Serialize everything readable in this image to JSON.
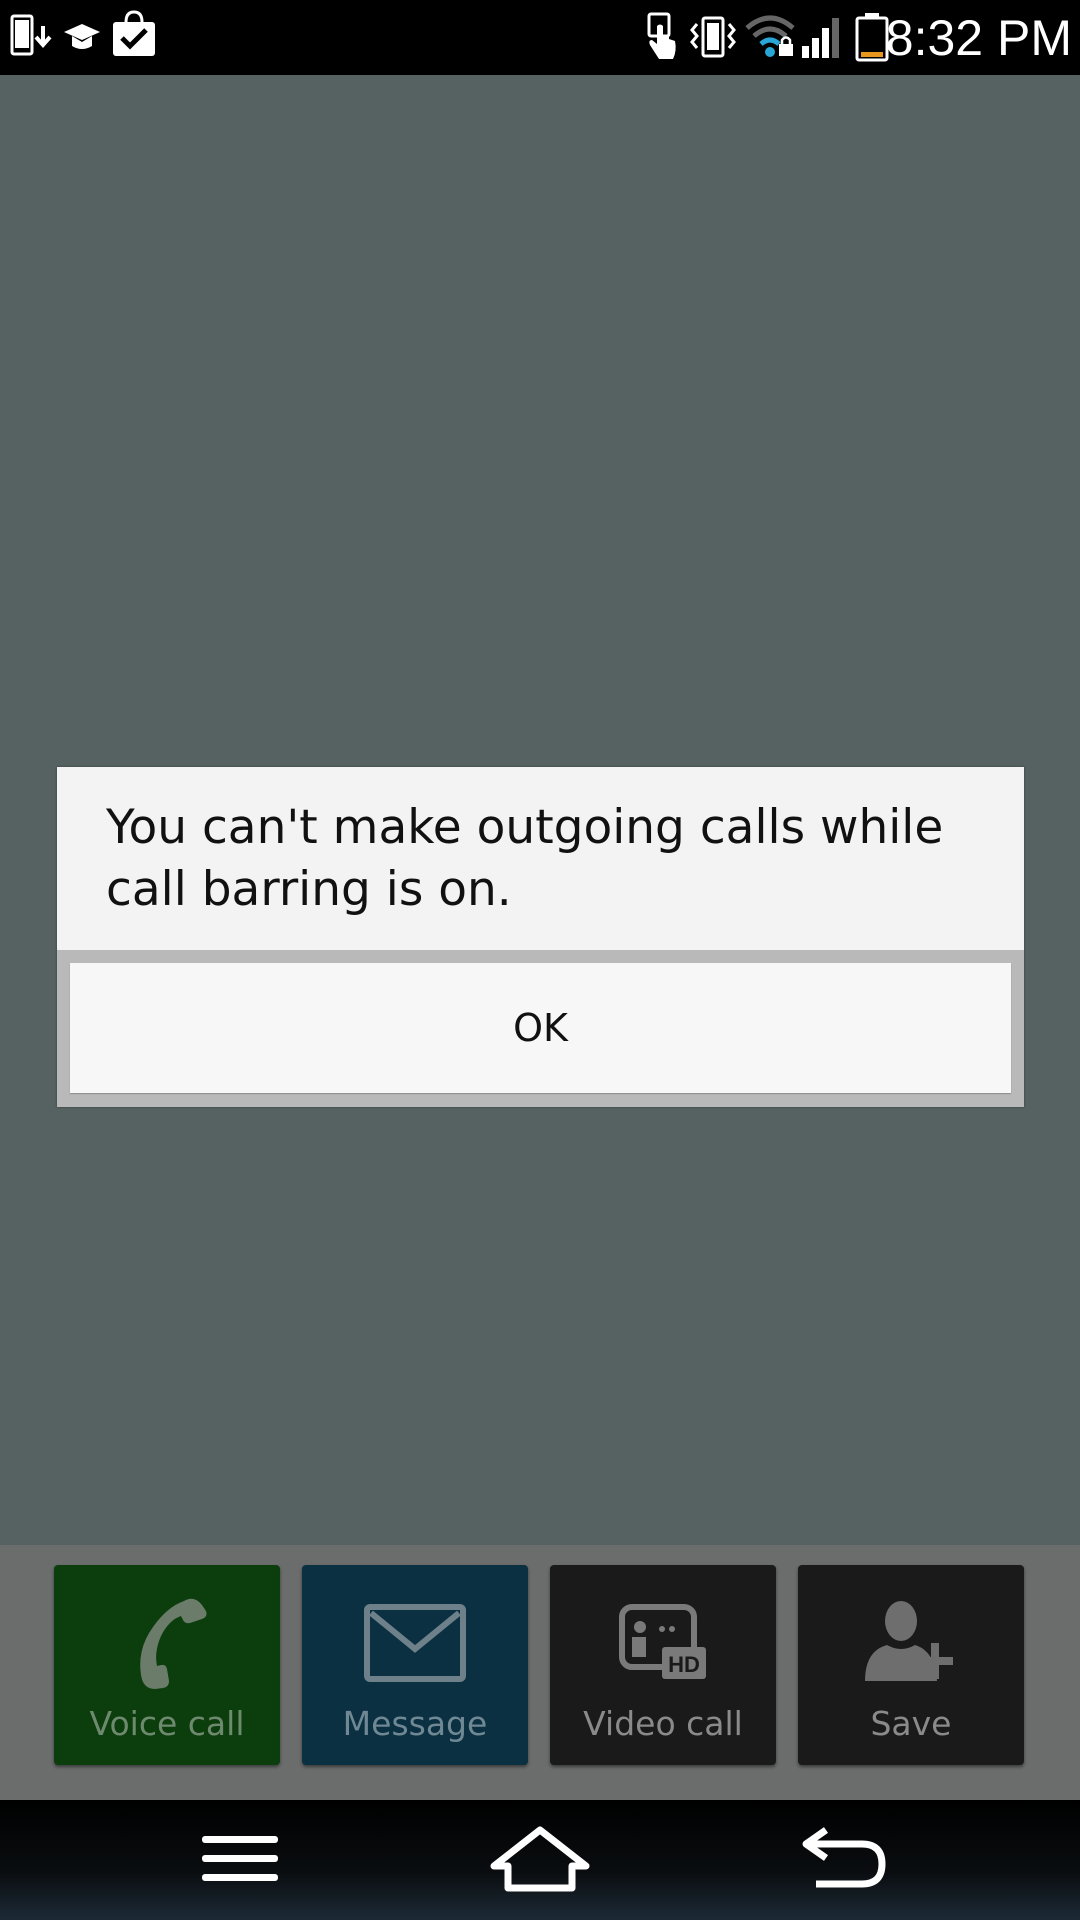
{
  "status_bar": {
    "time": "8:32 PM",
    "icons": [
      "download-notification-icon",
      "sync-icon",
      "shopping-bag-icon",
      "touch-icon",
      "vibrate-icon",
      "wifi-icon",
      "signal-icon",
      "battery-icon"
    ]
  },
  "dialog": {
    "message": "You can't make outgoing calls while call barring is on.",
    "ok_label": "OK"
  },
  "actions": [
    {
      "label": "Voice call",
      "icon": "phone-icon",
      "color": "#0c3d0c"
    },
    {
      "label": "Message",
      "icon": "envelope-icon",
      "color": "#0a3042"
    },
    {
      "label": "Video call",
      "icon": "video-call-hd-icon",
      "color": "#1a1a1a"
    },
    {
      "label": "Save",
      "icon": "add-contact-icon",
      "color": "#1a1a1a"
    }
  ],
  "nav": {
    "icons": [
      "menu-icon",
      "home-icon",
      "back-icon"
    ]
  },
  "colors": {
    "background": "#556261",
    "dialog_bg": "#f3f3f3",
    "battery_low": "#e8961e",
    "wifi_accent": "#2aa6d6"
  }
}
